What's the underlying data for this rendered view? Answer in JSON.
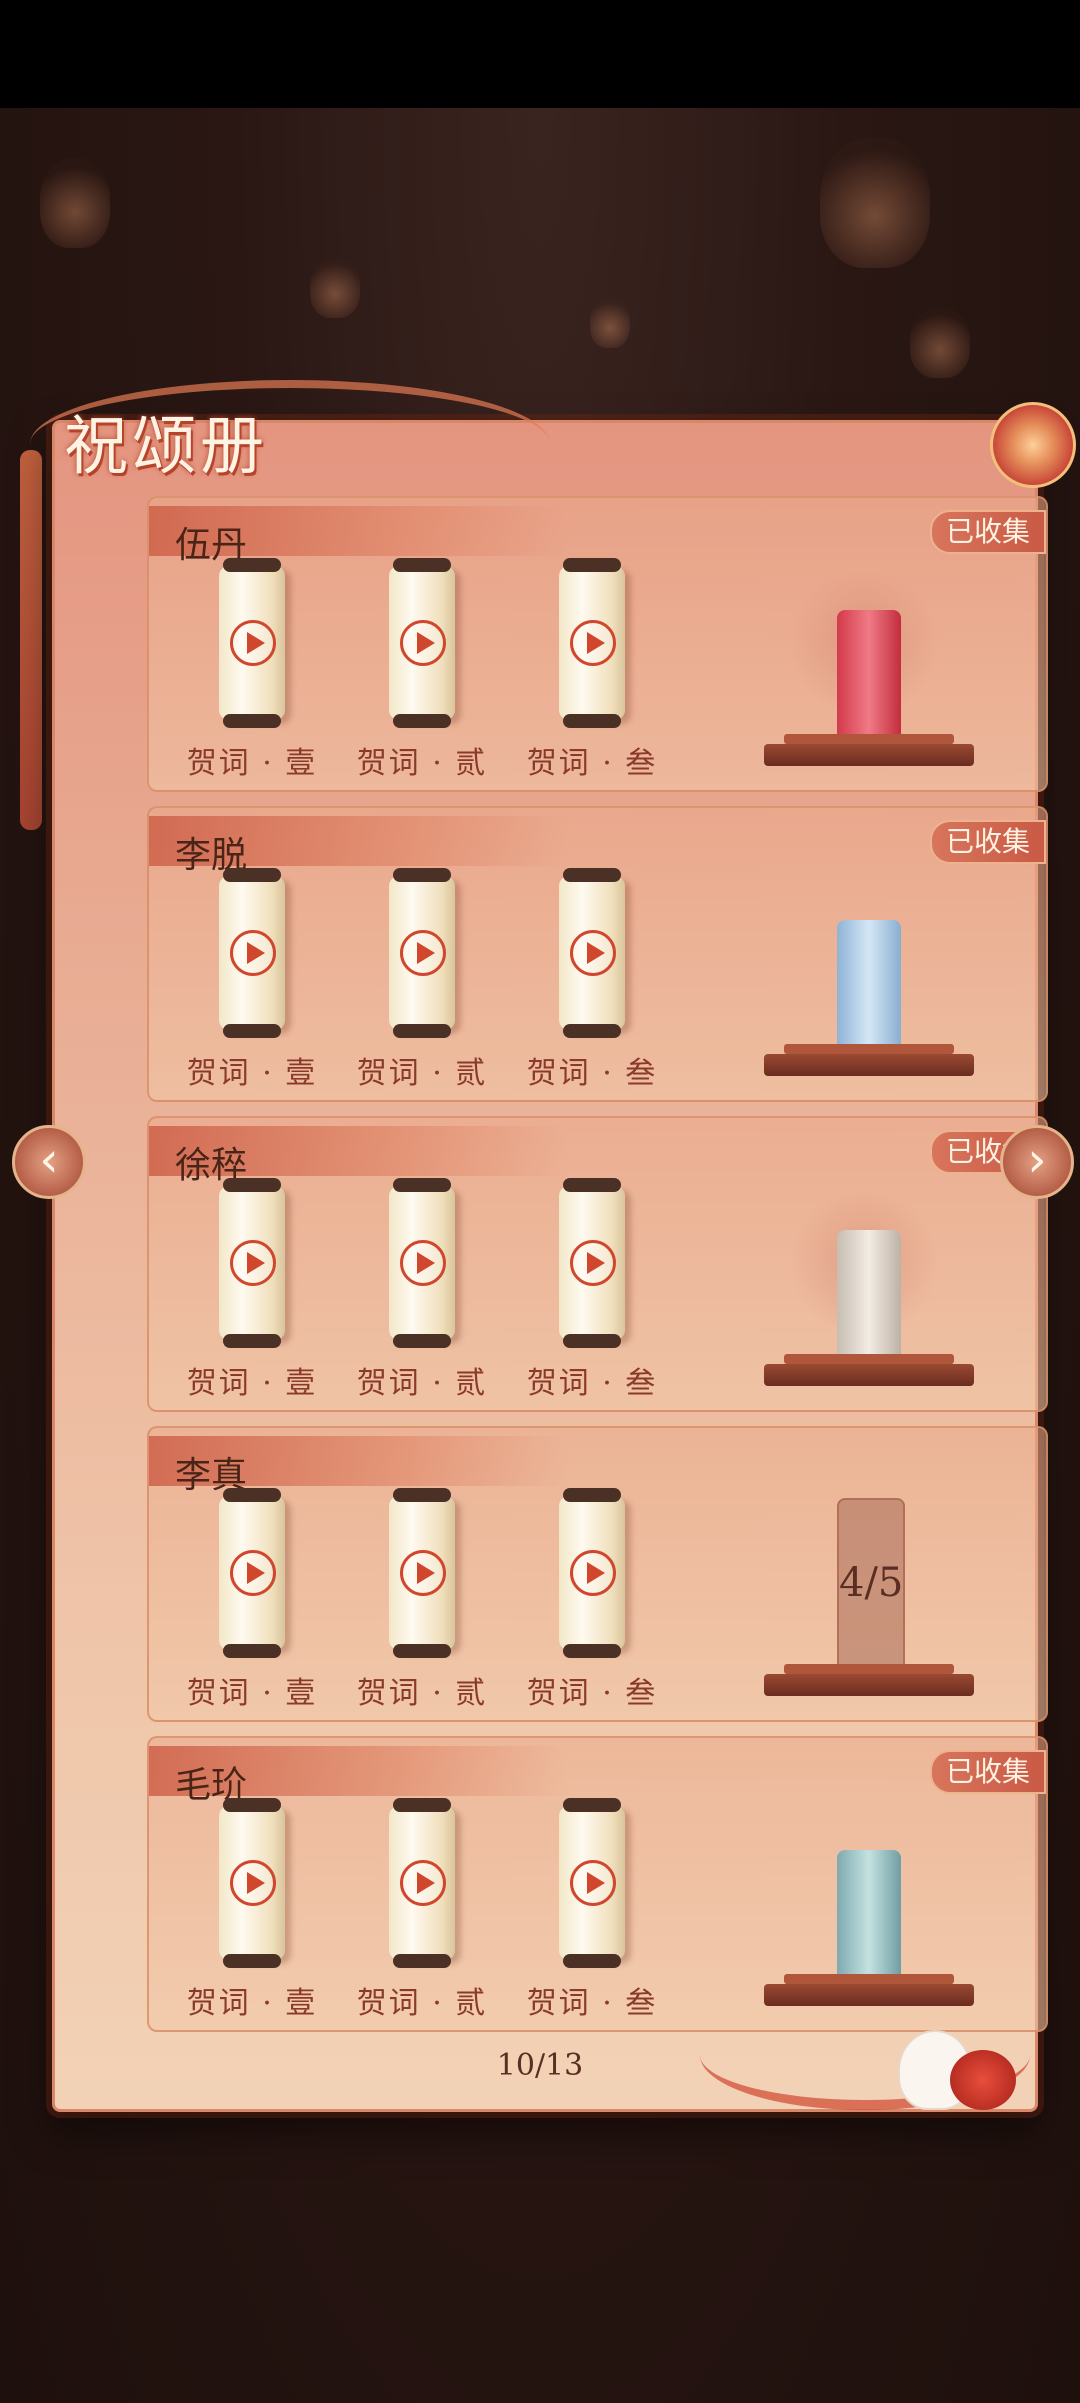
{
  "header": {
    "title": "祝颂册"
  },
  "navigation": {
    "prev_symbol": "‹",
    "next_symbol": "›"
  },
  "cards": [
    {
      "name": "伍丹",
      "collected": true,
      "badge": "已收集",
      "labels": [
        "贺词 · 壹",
        "贺词 · 贰",
        "贺词 · 叁"
      ],
      "seal": "red-seal-icon"
    },
    {
      "name": "李脱",
      "collected": true,
      "badge": "已收集",
      "labels": [
        "贺词 · 壹",
        "贺词 · 贰",
        "贺词 · 叁"
      ],
      "seal": "blue-seal-icon"
    },
    {
      "name": "徐稡",
      "collected": true,
      "badge": "已收集",
      "labels": [
        "贺词 · 壹",
        "贺词 · 贰",
        "贺词 · 叁"
      ],
      "seal": "white-seal-icon"
    },
    {
      "name": "李真",
      "collected": false,
      "progress": "4/5",
      "labels": [
        "贺词 · 壹",
        "贺词 · 贰",
        "贺词 · 叁"
      ],
      "seal": "locked-seal-icon"
    },
    {
      "name": "毛玠",
      "collected": true,
      "badge": "已收集",
      "labels": [
        "贺词 · 壹",
        "贺词 · 贰",
        "贺词 · 叁"
      ],
      "seal": "teal-seal-icon"
    }
  ],
  "pager": {
    "text": "10/13"
  },
  "colors": {
    "accent": "#d0472e",
    "badge_bg": "#c95a45",
    "text_dark": "#4a2417"
  }
}
